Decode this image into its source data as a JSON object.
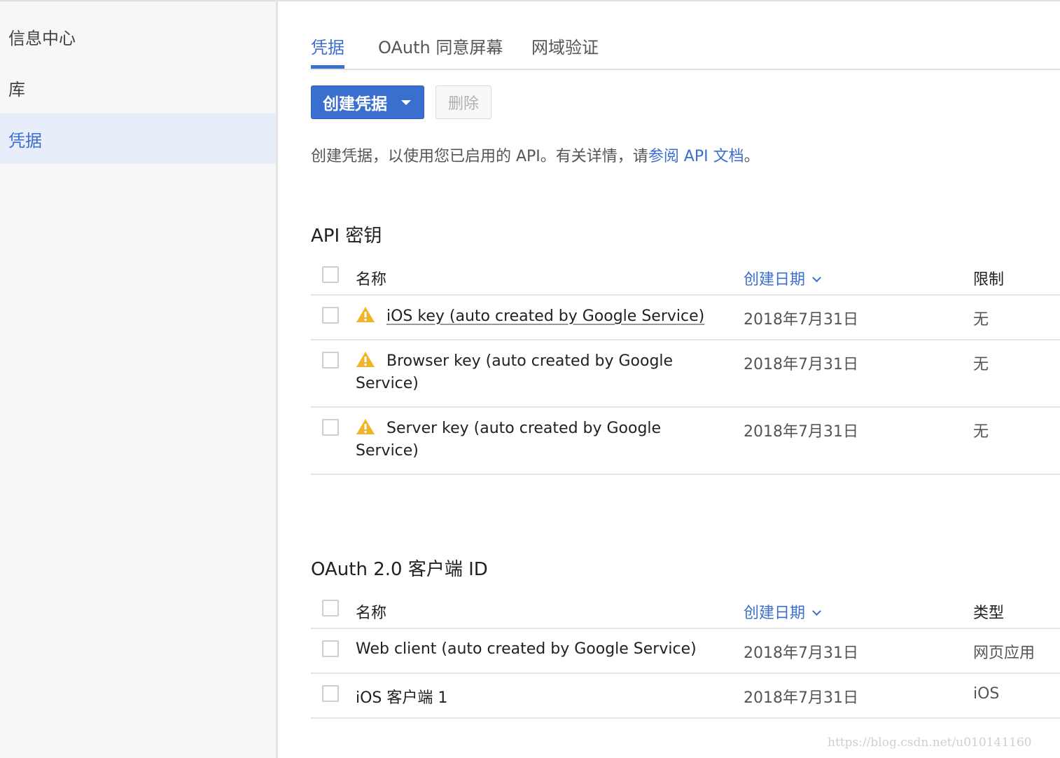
{
  "sidebar": {
    "items": [
      {
        "label": "信息中心"
      },
      {
        "label": "库"
      },
      {
        "label": "凭据"
      }
    ]
  },
  "tabs": [
    {
      "label": "凭据"
    },
    {
      "label": "OAuth 同意屏幕"
    },
    {
      "label": "网域验证"
    }
  ],
  "toolbar": {
    "create_label": "创建凭据",
    "delete_label": "删除"
  },
  "intro": {
    "text_before": "创建凭据，以使用您已启用的 API。有关详情，请",
    "link_text": "参阅 API 文档",
    "text_after": "。"
  },
  "api_keys": {
    "title": "API 密钥",
    "headers": {
      "name": "名称",
      "date": "创建日期",
      "restriction": "限制"
    },
    "rows": [
      {
        "name": "iOS key (auto created by Google Service)",
        "date": "2018年7月31日",
        "restriction": "无"
      },
      {
        "name_line1": "Browser key (auto created by Google",
        "name_line2": "Service)",
        "date": "2018年7月31日",
        "restriction": "无"
      },
      {
        "name_line1": "Server key (auto created by Google",
        "name_line2": "Service)",
        "date": "2018年7月31日",
        "restriction": "无"
      }
    ]
  },
  "oauth_clients": {
    "title": "OAuth 2.0 客户端 ID",
    "headers": {
      "name": "名称",
      "date": "创建日期",
      "type": "类型"
    },
    "rows": [
      {
        "name": "Web client (auto created by Google Service)",
        "date": "2018年7月31日",
        "type": "网页应用"
      },
      {
        "name": "iOS 客户端 1",
        "date": "2018年7月31日",
        "type": "iOS"
      }
    ]
  },
  "watermark": "https://blog.csdn.net/u010141160",
  "colors": {
    "accent": "#3b6fcf",
    "warning": "#f0b429",
    "active_bg": "#e8eef9"
  },
  "icons": {
    "warning": "warning-triangle-icon",
    "dropdown": "caret-down-icon",
    "sort": "chevron-down-icon"
  }
}
